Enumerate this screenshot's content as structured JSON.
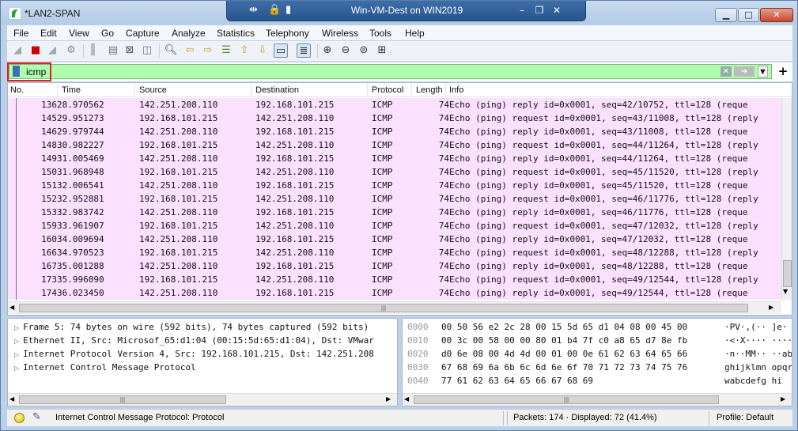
{
  "window": {
    "title": "*LAN2-SPAN",
    "vm_title": "Win-VM-Dest on WIN2019"
  },
  "menu": [
    "File",
    "Edit",
    "View",
    "Go",
    "Capture",
    "Analyze",
    "Statistics",
    "Telephony",
    "Wireless",
    "Tools",
    "Help"
  ],
  "filter": {
    "value": "icmp"
  },
  "columns": [
    "No.",
    "Time",
    "Source",
    "Destination",
    "Protocol",
    "Length",
    "Info"
  ],
  "packets": [
    {
      "no": "136",
      "time": "28.970562",
      "src": "142.251.208.110",
      "dst": "192.168.101.215",
      "proto": "ICMP",
      "len": "74",
      "info": "Echo (ping) reply     id=0x0001, seq=42/10752, ttl=128 (reque"
    },
    {
      "no": "145",
      "time": "29.951273",
      "src": "192.168.101.215",
      "dst": "142.251.208.110",
      "proto": "ICMP",
      "len": "74",
      "info": "Echo (ping) request   id=0x0001, seq=43/11008, ttl=128 (reply"
    },
    {
      "no": "146",
      "time": "29.979744",
      "src": "142.251.208.110",
      "dst": "192.168.101.215",
      "proto": "ICMP",
      "len": "74",
      "info": "Echo (ping) reply     id=0x0001, seq=43/11008, ttl=128 (reque"
    },
    {
      "no": "148",
      "time": "30.982227",
      "src": "192.168.101.215",
      "dst": "142.251.208.110",
      "proto": "ICMP",
      "len": "74",
      "info": "Echo (ping) request   id=0x0001, seq=44/11264, ttl=128 (reply"
    },
    {
      "no": "149",
      "time": "31.005469",
      "src": "142.251.208.110",
      "dst": "192.168.101.215",
      "proto": "ICMP",
      "len": "74",
      "info": "Echo (ping) reply     id=0x0001, seq=44/11264, ttl=128 (reque"
    },
    {
      "no": "150",
      "time": "31.968948",
      "src": "192.168.101.215",
      "dst": "142.251.208.110",
      "proto": "ICMP",
      "len": "74",
      "info": "Echo (ping) request   id=0x0001, seq=45/11520, ttl=128 (reply"
    },
    {
      "no": "151",
      "time": "32.006541",
      "src": "142.251.208.110",
      "dst": "192.168.101.215",
      "proto": "ICMP",
      "len": "74",
      "info": "Echo (ping) reply     id=0x0001, seq=45/11520, ttl=128 (reque"
    },
    {
      "no": "152",
      "time": "32.952881",
      "src": "192.168.101.215",
      "dst": "142.251.208.110",
      "proto": "ICMP",
      "len": "74",
      "info": "Echo (ping) request   id=0x0001, seq=46/11776, ttl=128 (reply"
    },
    {
      "no": "153",
      "time": "32.983742",
      "src": "142.251.208.110",
      "dst": "192.168.101.215",
      "proto": "ICMP",
      "len": "74",
      "info": "Echo (ping) reply     id=0x0001, seq=46/11776, ttl=128 (reque"
    },
    {
      "no": "159",
      "time": "33.961907",
      "src": "192.168.101.215",
      "dst": "142.251.208.110",
      "proto": "ICMP",
      "len": "74",
      "info": "Echo (ping) request   id=0x0001, seq=47/12032, ttl=128 (reply"
    },
    {
      "no": "160",
      "time": "34.009694",
      "src": "142.251.208.110",
      "dst": "192.168.101.215",
      "proto": "ICMP",
      "len": "74",
      "info": "Echo (ping) reply     id=0x0001, seq=47/12032, ttl=128 (reque"
    },
    {
      "no": "166",
      "time": "34.970523",
      "src": "192.168.101.215",
      "dst": "142.251.208.110",
      "proto": "ICMP",
      "len": "74",
      "info": "Echo (ping) request   id=0x0001, seq=48/12288, ttl=128 (reply"
    },
    {
      "no": "167",
      "time": "35.001288",
      "src": "142.251.208.110",
      "dst": "192.168.101.215",
      "proto": "ICMP",
      "len": "74",
      "info": "Echo (ping) reply     id=0x0001, seq=48/12288, ttl=128 (reque"
    },
    {
      "no": "173",
      "time": "35.996090",
      "src": "192.168.101.215",
      "dst": "142.251.208.110",
      "proto": "ICMP",
      "len": "74",
      "info": "Echo (ping) request   id=0x0001, seq=49/12544, ttl=128 (reply"
    },
    {
      "no": "174",
      "time": "36.023450",
      "src": "142.251.208.110",
      "dst": "192.168.101.215",
      "proto": "ICMP",
      "len": "74",
      "info": "Echo (ping) reply     id=0x0001, seq=49/12544, ttl=128 (reque"
    }
  ],
  "details": [
    "Frame 5: 74 bytes on wire (592 bits), 74 bytes captured (592 bits)",
    "Ethernet II, Src: Microsof_65:d1:04 (00:15:5d:65:d1:04), Dst: VMwar",
    "Internet Protocol Version 4, Src: 192.168.101.215, Dst: 142.251.208",
    "Internet Control Message Protocol"
  ],
  "bytes": [
    {
      "offset": "0000",
      "hex": "00 50 56 e2 2c 28 00 15  5d 65 d1 04 08 00 45 00",
      "ascii": "·PV·,(·· ]e·"
    },
    {
      "offset": "0010",
      "hex": "00 3c 00 58 00 00 80 01  b4 7f c0 a8 65 d7 8e fb",
      "ascii": "·<·X···· ····"
    },
    {
      "offset": "0020",
      "hex": "d0 6e 08 00 4d 4d 00 01  00 0e 61 62 63 64 65 66",
      "ascii": "·n··MM·· ··ab"
    },
    {
      "offset": "0030",
      "hex": "67 68 69 6a 6b 6c 6d 6e  6f 70 71 72 73 74 75 76",
      "ascii": "ghijklmn opqr"
    },
    {
      "offset": "0040",
      "hex": "77 61 62 63 64 65 66 67  68 69",
      "ascii": "wabcdefg hi"
    }
  ],
  "status": {
    "message": "Internet Control Message Protocol: Protocol",
    "packets": "Packets: 174 · Displayed: 72 (41.4%)",
    "profile": "Profile: Default"
  },
  "icons": {
    "app": "wireshark-fin-icon",
    "status_led": "expert-info-led-icon",
    "status_edit": "capture-comment-icon"
  },
  "colors": {
    "icmp_row_bg": "#fce0ff",
    "filter_valid_bg": "#afffaf",
    "highlight_box": "#e02020"
  }
}
